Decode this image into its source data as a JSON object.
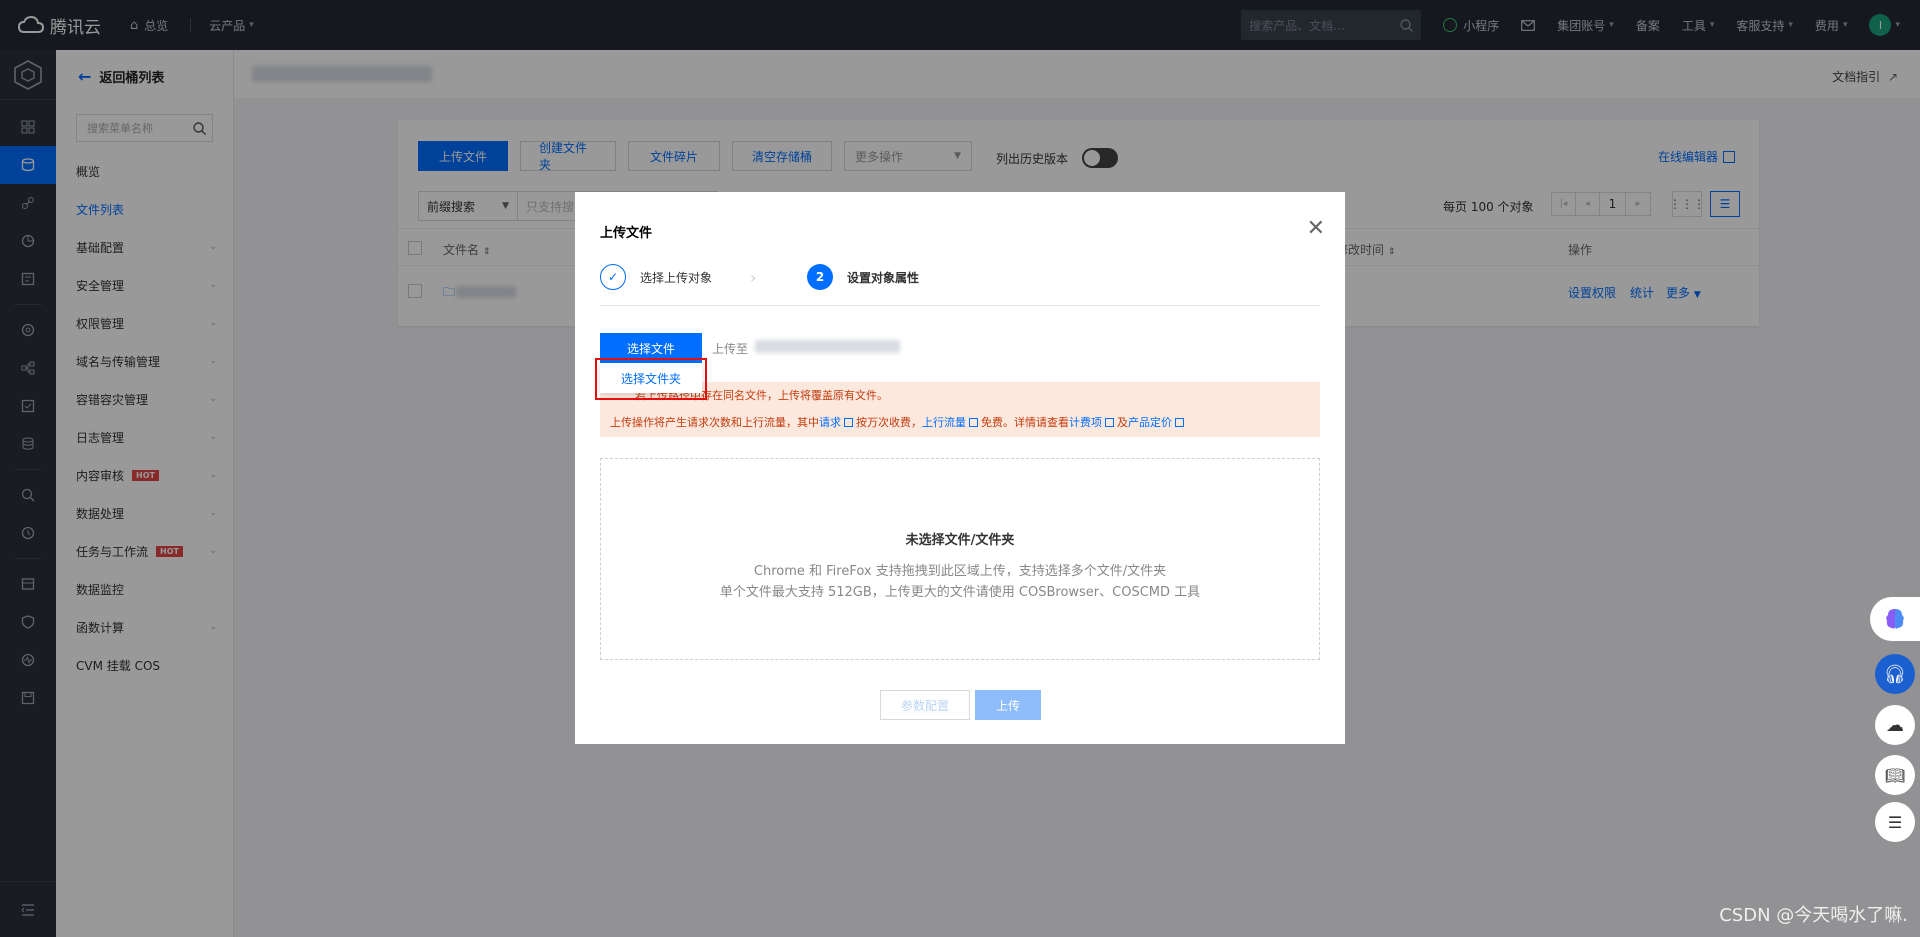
{
  "topbar": {
    "brand": "腾讯云",
    "nav": [
      {
        "label": "总览",
        "icon": "home-icon"
      },
      {
        "label": "云产品",
        "icon": "chevron-down-icon"
      }
    ],
    "search_placeholder": "搜索产品、文档...",
    "right_items": [
      {
        "label": "小程序"
      },
      {
        "label": "集团账号"
      },
      {
        "label": "备案"
      },
      {
        "label": "工具"
      },
      {
        "label": "客服支持"
      },
      {
        "label": "费用"
      }
    ],
    "avatar_letter": "I"
  },
  "menu": {
    "back_label": "返回桶列表",
    "search_placeholder": "搜索菜单名称",
    "items": [
      {
        "label": "概览",
        "has_chevron": false
      },
      {
        "label": "文件列表",
        "has_chevron": false,
        "active": true
      },
      {
        "label": "基础配置",
        "has_chevron": true
      },
      {
        "label": "安全管理",
        "has_chevron": true
      },
      {
        "label": "权限管理",
        "has_chevron": true
      },
      {
        "label": "域名与传输管理",
        "has_chevron": true
      },
      {
        "label": "容错容灾管理",
        "has_chevron": true
      },
      {
        "label": "日志管理",
        "has_chevron": true
      },
      {
        "label": "内容审核",
        "has_chevron": true,
        "badge": "HOT"
      },
      {
        "label": "数据处理",
        "has_chevron": true
      },
      {
        "label": "任务与工作流",
        "has_chevron": true,
        "badge": "HOT"
      },
      {
        "label": "数据监控",
        "has_chevron": false
      },
      {
        "label": "函数计算",
        "has_chevron": true
      },
      {
        "label": "CVM 挂载 COS",
        "has_chevron": false
      }
    ]
  },
  "content": {
    "doc_guide": "文档指引",
    "toolbar": {
      "upload_file": "上传文件",
      "create_folder": "创建文件夹",
      "file_fragments": "文件碎片",
      "clear_bucket": "清空存储桶",
      "more_ops": "更多操作",
      "history_label": "列出历史版本",
      "online_editor": "在线编辑器"
    },
    "filter": {
      "prefix_search": "前缀搜索",
      "input_placeholder": "只支持搜",
      "per_page": "每页 100 个对象",
      "page": "1"
    },
    "table": {
      "col_name": "文件名",
      "col_time": "修改时间",
      "col_ops": "操作",
      "row_ops": [
        "设置权限",
        "统计",
        "更多"
      ]
    }
  },
  "modal": {
    "title": "上传文件",
    "step1_label": "选择上传对象",
    "step2_number": "2",
    "step2_label": "设置对象属性",
    "choose_file": "选择文件",
    "upload_to": "上传至",
    "choose_folder": "选择文件夹",
    "warn_line1": "若上传路径中存在同名文件，上传将覆盖原有文件。",
    "warn_line2_pre": "上传操作将产生请求次数和上行流量，其中",
    "warn_link_request": "请求",
    "warn_mid1": "按万次收费，",
    "warn_link_upflow": "上行流量",
    "warn_mid2": "免费。详情请查看",
    "warn_link_billing": "计费项",
    "warn_mid3": "及",
    "warn_link_pricing": "产品定价",
    "dropzone_title": "未选择文件/文件夹",
    "dropzone_line1": "Chrome 和 FireFox 支持拖拽到此区域上传，支持选择多个文件/文件夹",
    "dropzone_line2": "单个文件最大支持 512GB，上传更大的文件请使用 COSBrowser、COSCMD 工具",
    "btn_params": "参数配置",
    "btn_upload": "上传"
  },
  "watermark": "CSDN @今天喝水了嘛."
}
